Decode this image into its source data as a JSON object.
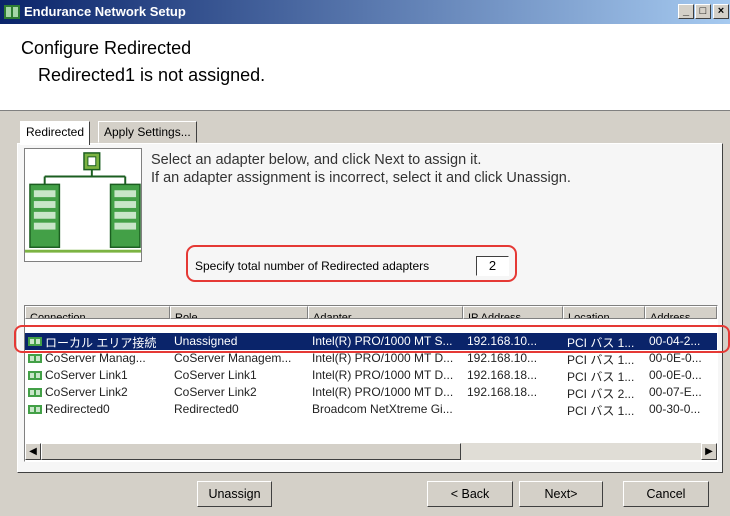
{
  "window": {
    "title": "Endurance Network Setup"
  },
  "header": {
    "title": "Configure Redirected",
    "subtitle": "Redirected1 is not assigned."
  },
  "tabs": [
    {
      "label": "Redirected"
    },
    {
      "label": "Apply Settings..."
    }
  ],
  "instructions": {
    "line1": "Select an adapter below, and click Next to assign it.",
    "line2": "If an adapter assignment is incorrect, select it and click Unassign."
  },
  "spec": {
    "label": "Specify total number of Redirected adapters",
    "value": "2"
  },
  "table": {
    "columns": [
      "Connection",
      "Role",
      "Adapter",
      "IP Address",
      "Location",
      "Address"
    ],
    "rows": [
      {
        "cells": [
          "ローカル エリア接続",
          "Unassigned",
          "Intel(R) PRO/1000 MT S...",
          "192.168.10...",
          "PCI バス 1...",
          "00-04-2..."
        ],
        "selected": true
      },
      {
        "cells": [
          "CoServer Manag...",
          "CoServer Managem...",
          "Intel(R) PRO/1000 MT D...",
          "192.168.10...",
          "PCI バス 1...",
          "00-0E-0..."
        ],
        "selected": false
      },
      {
        "cells": [
          "CoServer Link1",
          "CoServer Link1",
          "Intel(R) PRO/1000 MT D...",
          "192.168.18...",
          "PCI バス 1...",
          "00-0E-0..."
        ],
        "selected": false
      },
      {
        "cells": [
          "CoServer Link2",
          "CoServer Link2",
          "Intel(R) PRO/1000 MT D...",
          "192.168.18...",
          "PCI バス 2...",
          "00-07-E..."
        ],
        "selected": false
      },
      {
        "cells": [
          "Redirected0",
          "Redirected0",
          "Broadcom NetXtreme Gi...",
          "",
          "PCI バス 1...",
          "00-30-0..."
        ],
        "selected": false
      }
    ]
  },
  "buttons": {
    "unassign": "Unassign",
    "back": "< Back",
    "next": "Next>",
    "cancel": "Cancel"
  },
  "icons": {
    "app": "network-app-icon",
    "minimize": "minimize-icon",
    "maximize": "maximize-icon",
    "close": "close-icon",
    "network": "network-adapter-icon"
  },
  "colors": {
    "selection": "#0a246a",
    "highlight": "#e53935",
    "titlebar": "#0a246a"
  }
}
